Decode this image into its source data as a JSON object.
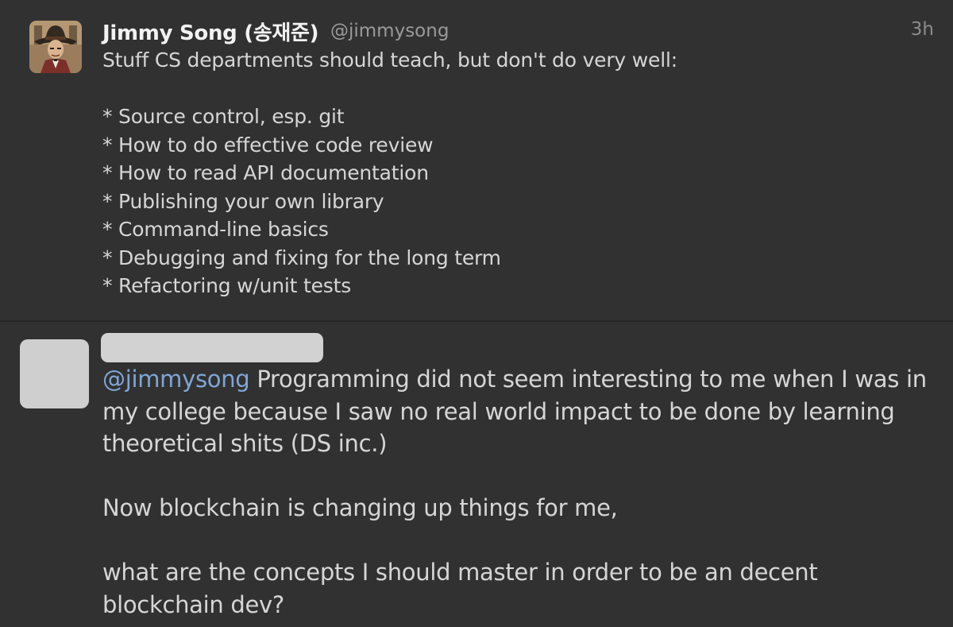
{
  "top_tweet": {
    "avatar_icon": "cowboy-avatar-icon",
    "display_name": "Jimmy Song (송재준)",
    "handle": "@jimmysong",
    "timestamp": "3h",
    "lines": [
      "Stuff CS departments should teach, but don't do very well:",
      "",
      "* Source control, esp. git",
      "* How to do effective code review",
      "* How to read API documentation",
      "* Publishing your own library",
      "* Command-line basics",
      "* Debugging and fixing for the long term",
      "* Refactoring w/unit tests"
    ]
  },
  "reply_tweet": {
    "avatar_icon": "redacted-avatar-placeholder",
    "mention": "@jimmysong",
    "paragraph_1": " Programming did not seem interesting to me when I was in my college because I saw no real world impact to be done by learning theoretical shits (DS inc.)",
    "paragraph_2": "Now blockchain is changing up things for me,",
    "paragraph_3": "what are the concepts I should master in order to be an decent blockchain dev?"
  },
  "colors": {
    "background": "#313131",
    "separator": "#262626",
    "mention": "#7fa6d6",
    "text": "#d6d6d6"
  }
}
